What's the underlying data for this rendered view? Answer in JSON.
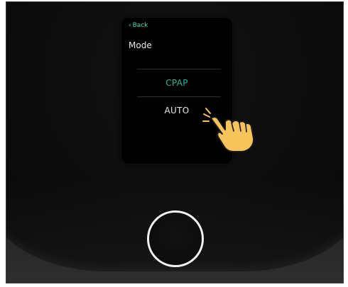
{
  "screen": {
    "back_label": "Back",
    "title": "Mode",
    "options": [
      {
        "label": "CPAP"
      },
      {
        "label": "AUTO"
      }
    ]
  },
  "colors": {
    "accent": "#3fd2b8",
    "selected_option": "#2fb39c",
    "text": "#e8e8e8",
    "hand": "#f7c45c"
  },
  "icons": {
    "back": "chevron-left-icon",
    "pointer": "pointing-hand-icon",
    "power_button": "power-ring-icon"
  }
}
